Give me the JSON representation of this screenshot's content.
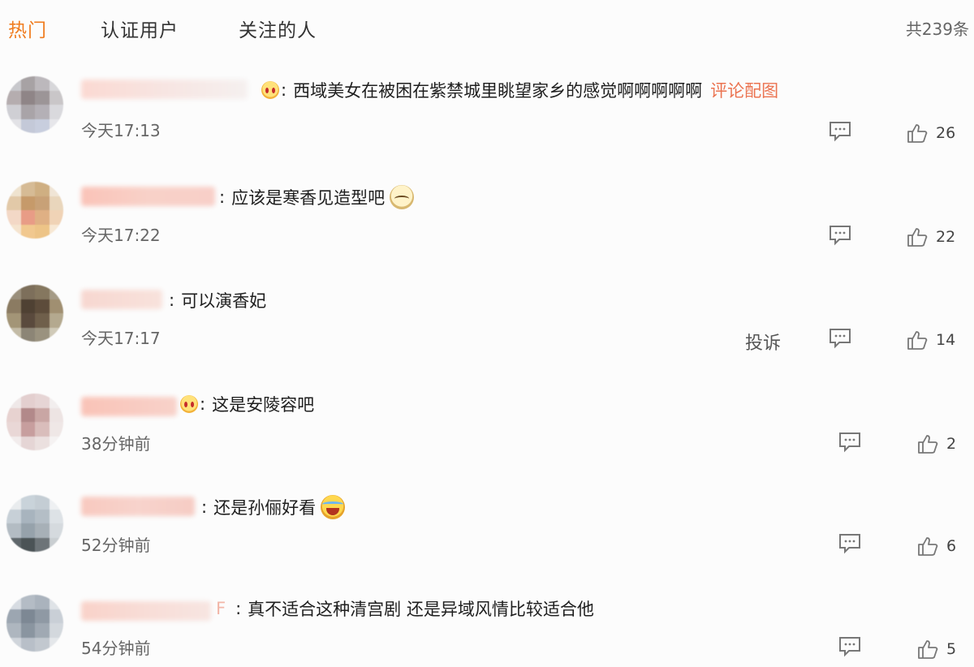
{
  "tabs": {
    "hot": "热门",
    "verified": "认证用户",
    "following": "关注的人"
  },
  "total": "共239条",
  "colors": {
    "accent": "#f07c1e",
    "link": "#eb7350"
  },
  "comments": [
    {
      "text": "西域美女在被困在紫禁城里眺望家乡的感觉啊啊啊啊啊",
      "link": "评论配图",
      "name_emoji": "crying-face",
      "time": "今天17:13",
      "likes": "26"
    },
    {
      "text": "应该是寒香见造型吧",
      "emoji": "shy-face",
      "time": "今天17:22",
      "likes": "22"
    },
    {
      "text": "可以演香妃",
      "time": "今天17:17",
      "report": "投诉",
      "likes": "14"
    },
    {
      "text": "这是安陵容吧",
      "name_emoji": "crying-face",
      "time": "38分钟前",
      "likes": "2"
    },
    {
      "text": "还是孙俪好看",
      "emoji": "laughing-tears-face",
      "time": "52分钟前",
      "likes": "6"
    },
    {
      "text": "真不适合这种清宫剧 还是异域风情比较适合他",
      "name_tail": "F",
      "time": "54分钟前",
      "likes": "5"
    }
  ]
}
